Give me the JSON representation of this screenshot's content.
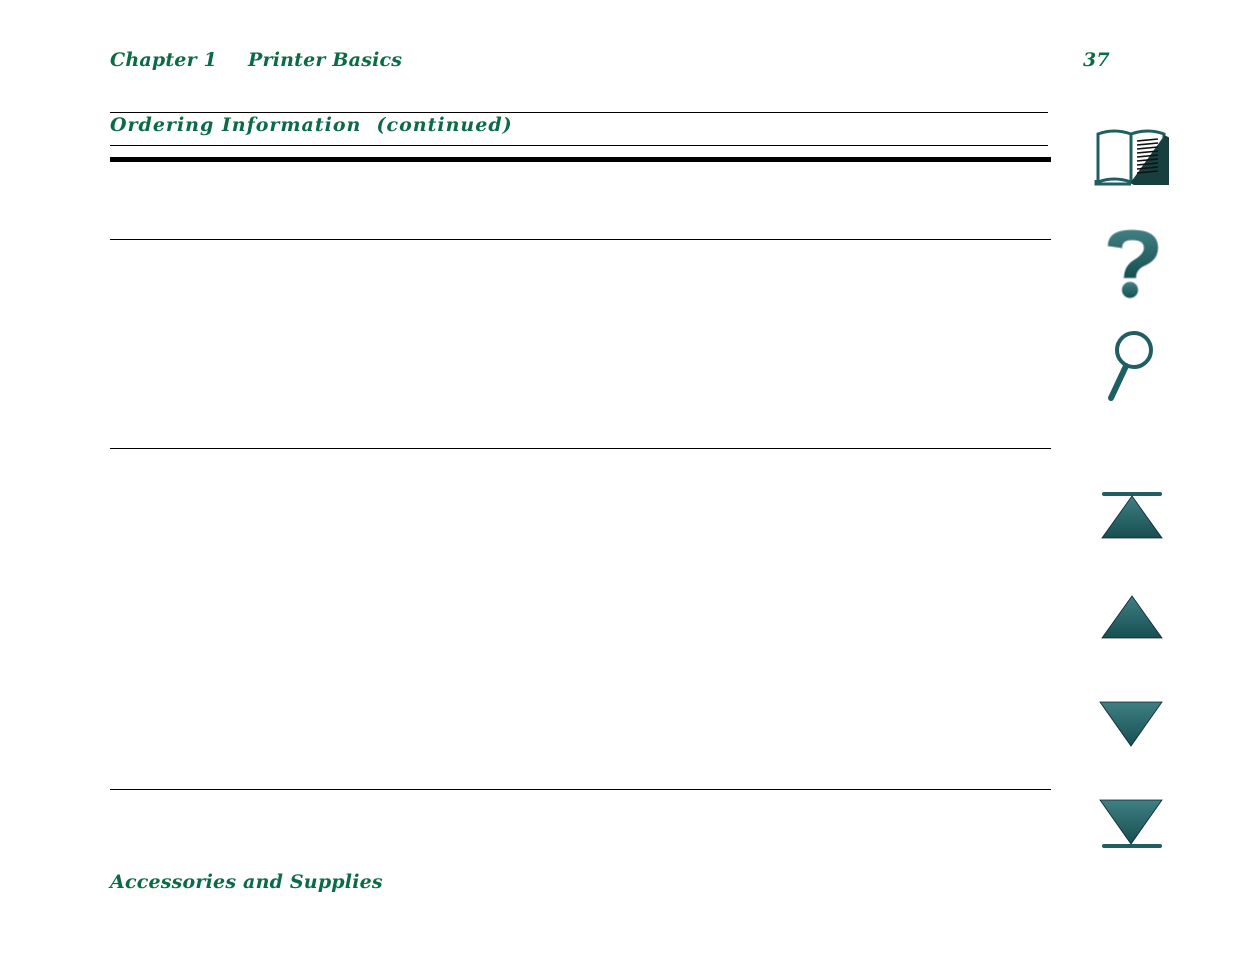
{
  "header": {
    "chapter": "Chapter 1",
    "section": "Printer Basics",
    "page_number": "37"
  },
  "table": {
    "title": "Ordering Information  (continued)",
    "rows": [
      {
        "cells": []
      },
      {
        "cells": []
      },
      {
        "cells": []
      }
    ]
  },
  "footer": {
    "title": "Accessories and Supplies"
  },
  "nav": {
    "items": [
      {
        "icon": "book-icon",
        "label": "Contents"
      },
      {
        "icon": "question-icon",
        "label": "Help"
      },
      {
        "icon": "magnifier-icon",
        "label": "Index"
      },
      {
        "icon": "first-page-icon",
        "label": "First page"
      },
      {
        "icon": "previous-page-icon",
        "label": "Previous page"
      },
      {
        "icon": "next-page-icon",
        "label": "Next page"
      },
      {
        "icon": "last-page-icon",
        "label": "Last page"
      }
    ]
  },
  "colors": {
    "text_accent": "#0b6b46",
    "icon_teal": "#1f5f62"
  }
}
